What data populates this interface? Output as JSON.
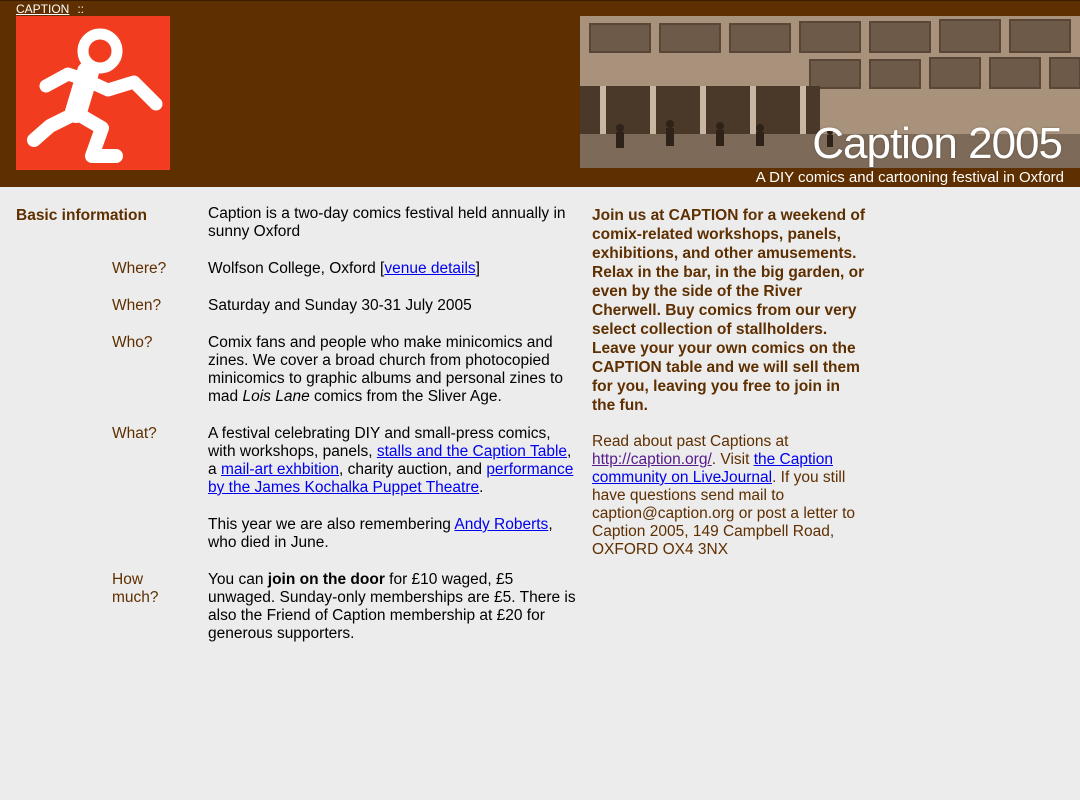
{
  "header": {
    "nav_link": "CAPTION",
    "nav_sep": "::",
    "photo_title": "Caption 2005",
    "tagline": "A DIY comics and cartooning festival in Oxford"
  },
  "colors": {
    "header_bg": "#5e2f00",
    "logo_bg": "#f23c1f",
    "page_bg": "#ececec",
    "accent_text": "#5e2f00",
    "link": "#0000ee"
  },
  "basic": {
    "section_label": "Basic information",
    "intro": "Caption is a two-day comics festival held annually in sunny Oxford",
    "where_label": "Where?",
    "where_text": "Wolfson College, Oxford ",
    "where_link": "venue details",
    "when_label": "When?",
    "when_text": "Saturday and Sunday 30-31 July 2005",
    "who_label": "Who?",
    "who_text_1": "Comix fans and people who make minicomics and zines. We cover a broad church from photocopied minicomics to graphic albums and personal zines to mad ",
    "who_em": "Lois Lane",
    "who_text_2": " comics from the Sliver Age.",
    "what_label": "What?",
    "what_text_1": "A festival celebrating DIY and small-press comics, with workshops, panels, ",
    "what_link_1": "stalls and the Caption Table",
    "what_text_2": ", a ",
    "what_link_2": "mail-art exhbition",
    "what_text_3": ", charity auction, and ",
    "what_link_3": "performance by the James Kochalka Puppet Theatre",
    "what_text_4": ".",
    "remember_text_1": "This year we are also remembering ",
    "remember_link": "Andy Roberts",
    "remember_text_2": ", who died in June.",
    "howmuch_label_1": "How",
    "howmuch_label_2": "much?",
    "howmuch_text_1": "You can ",
    "howmuch_bold": "join on the door",
    "howmuch_text_2": " for £10 waged, £5 unwaged. Sunday-only memberships are £5. There is also the Friend of Caption membership at £20 for generous supporters."
  },
  "sidebar": {
    "intro": "Join us at CAPTION for a weekend of comix-related workshops, panels, exhibitions, and other amusements. Relax in the bar, in the big garden, or even by the side of the River Cherwell. Buy comics from our very select collection of stallholders. Leave your your own comics on the CAPTION table and we will sell them for you, leaving you free to join in the fun.",
    "contact_1": "Read about past Captions at ",
    "contact_link_1": "http://caption.org/",
    "contact_2": ". Visit ",
    "contact_link_2": "the Caption community on LiveJournal",
    "contact_3": ". If you still have questions send mail to caption@caption.org or post a letter to Caption 2005, 149 Campbell Road, OXFORD OX4 3NX"
  }
}
